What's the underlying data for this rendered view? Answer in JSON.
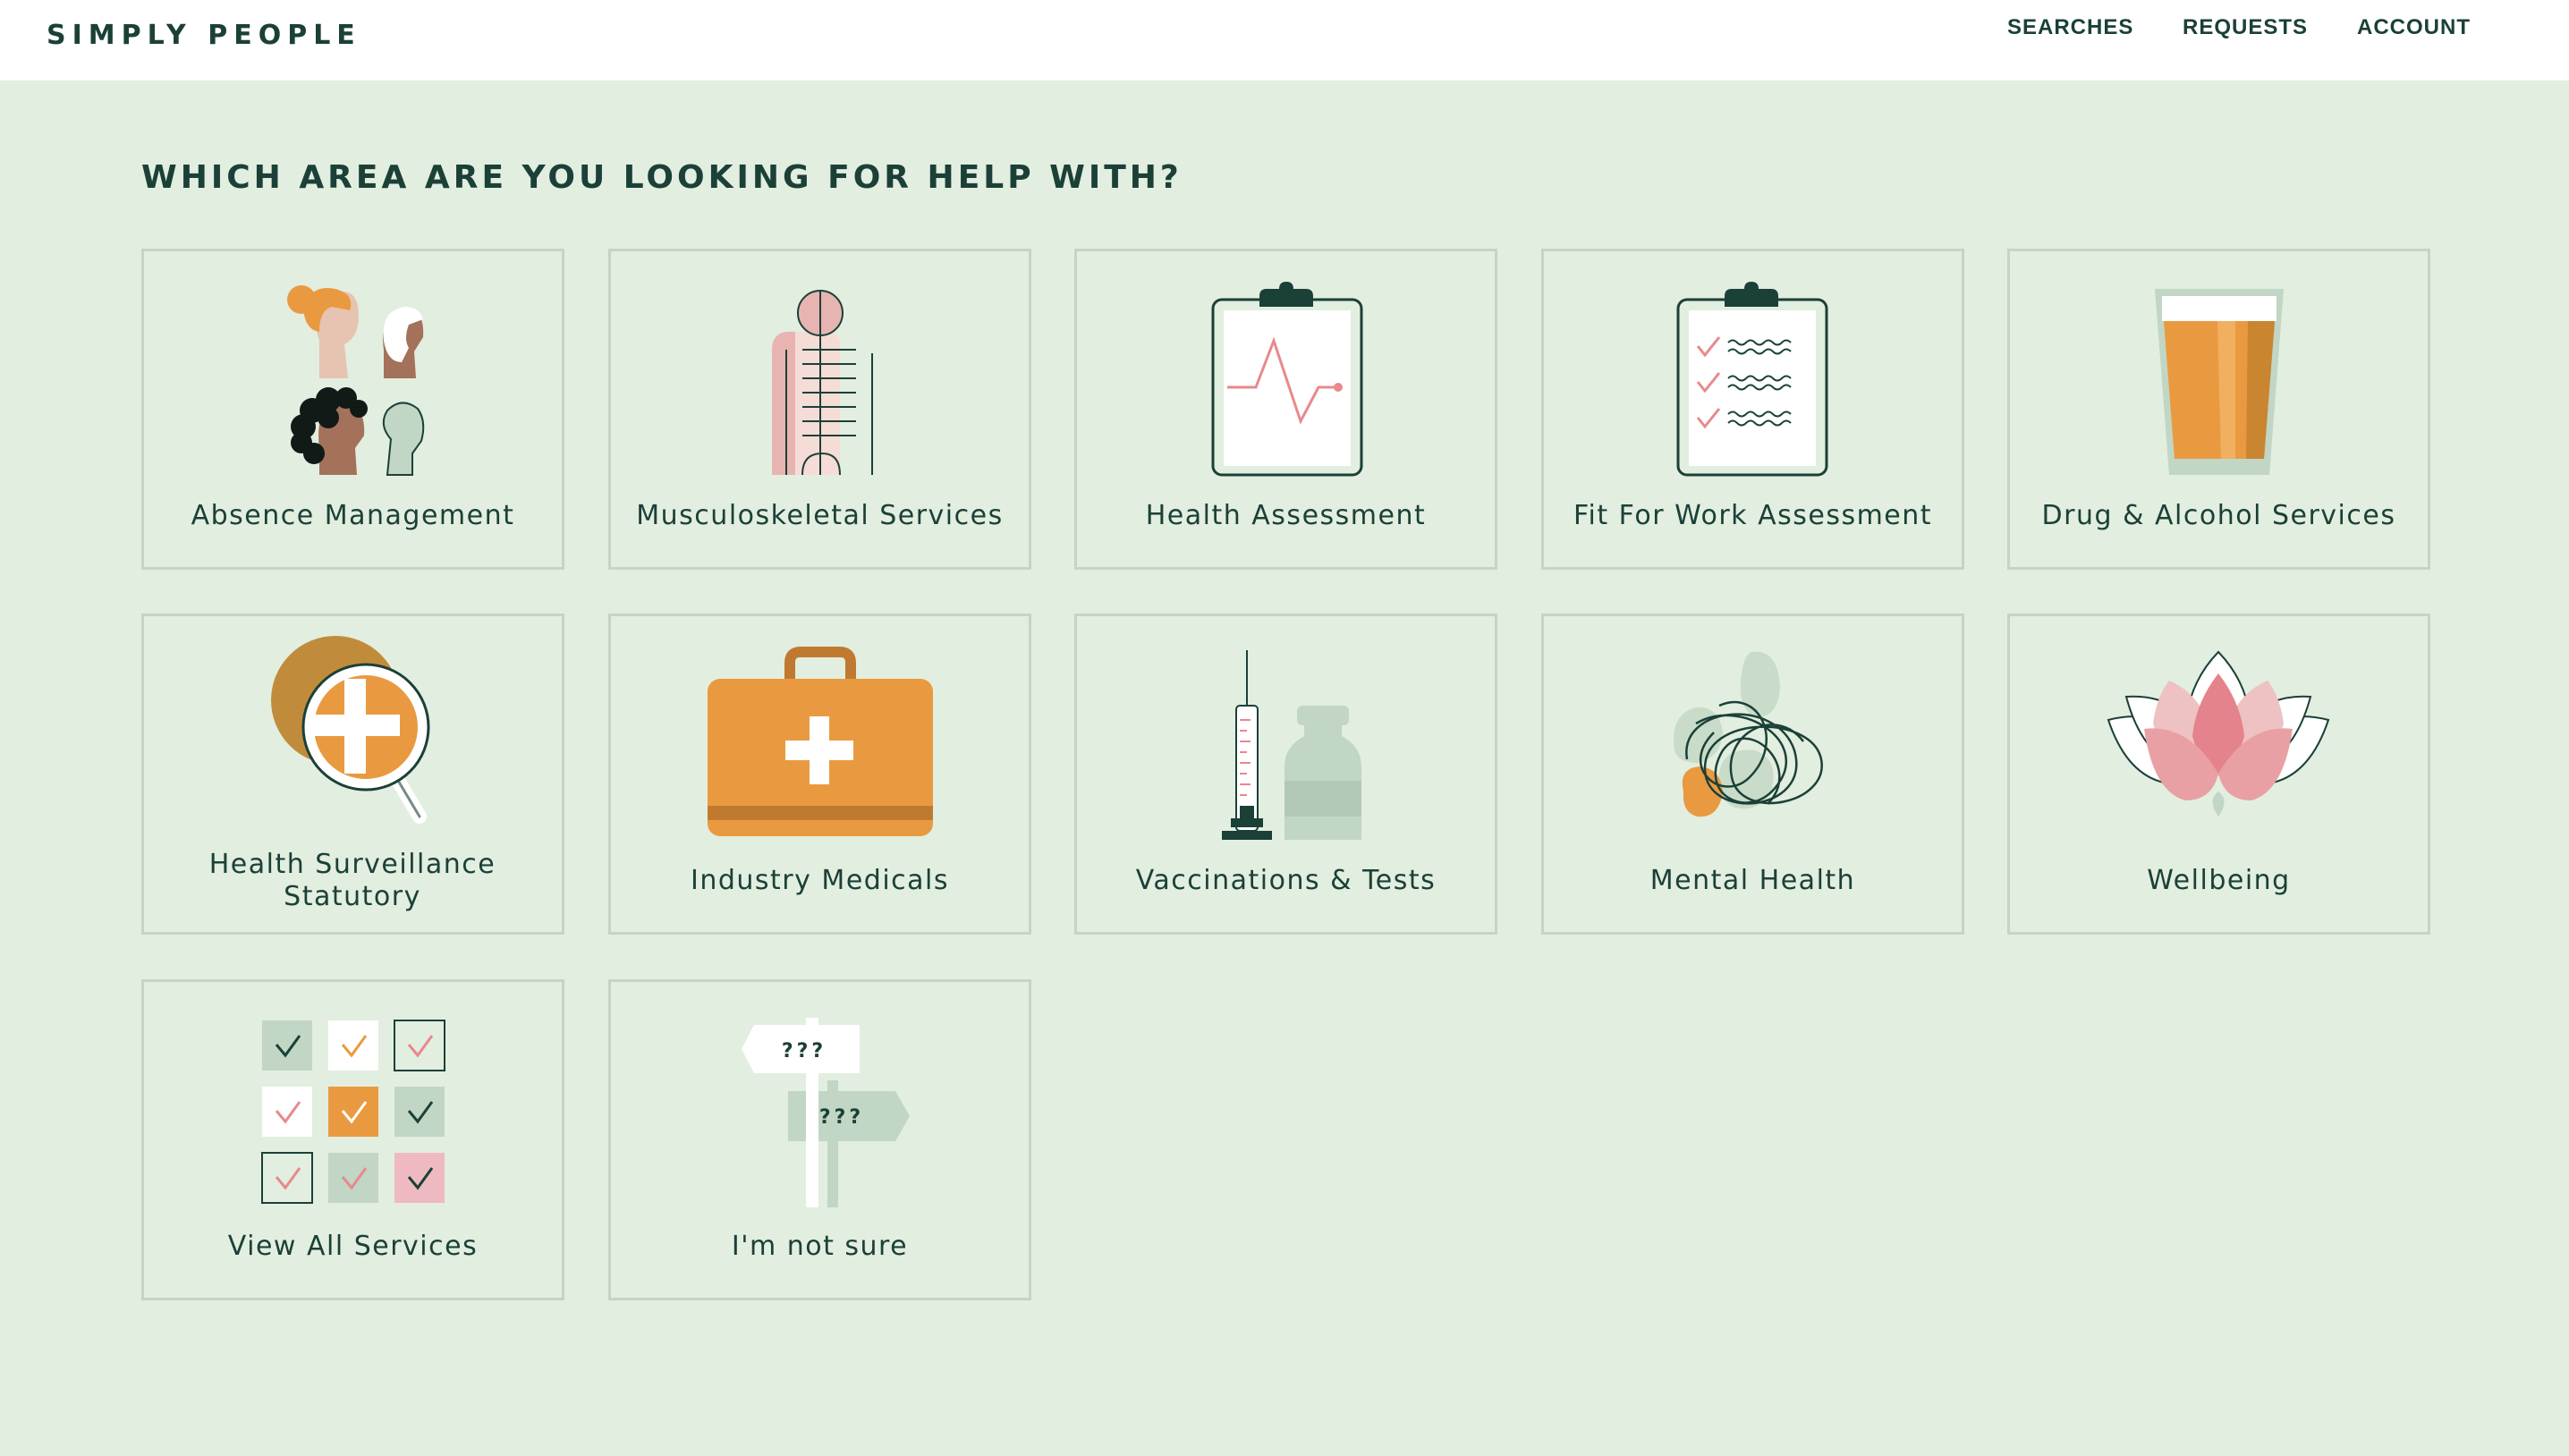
{
  "header": {
    "logo": "SIMPLY PEOPLE",
    "nav": [
      "SEARCHES",
      "REQUESTS",
      "ACCOUNT"
    ]
  },
  "main": {
    "title": "WHICH AREA ARE YOU LOOKING FOR HELP WITH?",
    "services": [
      {
        "label": "Absence Management",
        "icon": "people-icon"
      },
      {
        "label": "Musculoskeletal Services",
        "icon": "skeleton-icon"
      },
      {
        "label": "Health Assessment",
        "icon": "clipboard-chart-icon"
      },
      {
        "label": "Fit For Work Assessment",
        "icon": "clipboard-checklist-icon"
      },
      {
        "label": "Drug & Alcohol Services",
        "icon": "beer-glass-icon"
      },
      {
        "label": "Health Surveillance Statutory",
        "icon": "magnifier-cross-icon"
      },
      {
        "label": "Industry Medicals",
        "icon": "medical-case-icon"
      },
      {
        "label": "Vaccinations & Tests",
        "icon": "syringe-vial-icon"
      },
      {
        "label": "Mental Health",
        "icon": "tangled-mind-icon"
      },
      {
        "label": "Wellbeing",
        "icon": "lotus-icon"
      },
      {
        "label": "View All Services",
        "icon": "checkbox-grid-icon"
      },
      {
        "label": "I'm not sure",
        "icon": "signpost-icon"
      }
    ],
    "signpost_text": "???"
  },
  "colors": {
    "background": "#e2eedf",
    "header_bg": "#ffffff",
    "text": "#1b4038",
    "card_border": "#c7d3c4",
    "orange": "#e99a40",
    "pink": "#e8a1a5",
    "sage": "#c1d6c4"
  }
}
